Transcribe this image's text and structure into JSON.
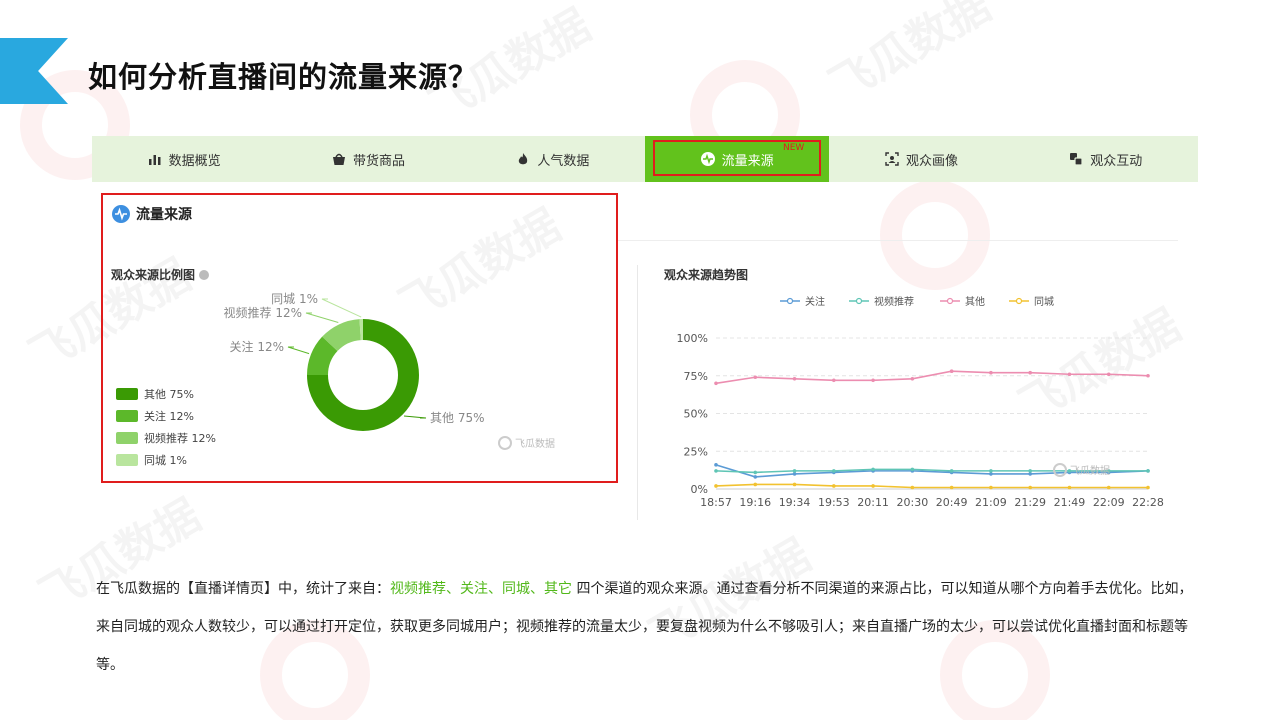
{
  "page": {
    "title": "如何分析直播间的流量来源？"
  },
  "tabs": [
    {
      "label": "数据概览"
    },
    {
      "label": "带货商品"
    },
    {
      "label": "人气数据"
    },
    {
      "label": "流量来源",
      "badge": "NEW",
      "active": true
    },
    {
      "label": "观众画像"
    },
    {
      "label": "观众互动"
    }
  ],
  "section": {
    "title": "流量来源"
  },
  "donut": {
    "title": "观众来源比例图",
    "chart_data": {
      "type": "pie",
      "slices": [
        {
          "name": "其他",
          "value": 75,
          "label": "其他 75%",
          "color": "#3a9a04"
        },
        {
          "name": "关注",
          "value": 12,
          "label": "关注 12%",
          "color": "#5cb82a"
        },
        {
          "name": "视频推荐",
          "value": 12,
          "label": "视频推荐 12%",
          "color": "#8fd26a"
        },
        {
          "name": "同城",
          "value": 1,
          "label": "同城 1%",
          "color": "#b9e59e"
        }
      ]
    },
    "watermark": "飞瓜数据"
  },
  "trend": {
    "title": "观众来源趋势图",
    "chart_data": {
      "type": "line",
      "x": [
        "18:57",
        "19:16",
        "19:34",
        "19:53",
        "20:11",
        "20:30",
        "20:49",
        "21:09",
        "21:29",
        "21:49",
        "22:09",
        "22:28"
      ],
      "y_ticks": [
        "100%",
        "75%",
        "50%",
        "25%",
        "0%"
      ],
      "ylim": [
        0,
        100
      ],
      "legend_position": "top",
      "grid": true,
      "series": [
        {
          "name": "关注",
          "color": "#5b9bd5",
          "values": [
            16,
            8,
            10,
            11,
            12,
            12,
            11,
            10,
            10,
            11,
            11,
            12
          ]
        },
        {
          "name": "视频推荐",
          "color": "#5fc5b5",
          "values": [
            12,
            11,
            12,
            12,
            13,
            13,
            12,
            12,
            12,
            12,
            12,
            12
          ]
        },
        {
          "name": "其他",
          "color": "#ec8db0",
          "values": [
            70,
            74,
            73,
            72,
            72,
            73,
            78,
            77,
            77,
            76,
            76,
            75
          ]
        },
        {
          "name": "同城",
          "color": "#f2c230",
          "values": [
            2,
            3,
            3,
            2,
            2,
            1,
            1,
            1,
            1,
            1,
            1,
            1
          ]
        }
      ]
    },
    "watermark": "飞瓜数据"
  },
  "description": {
    "intro": "在飞瓜数据的【直播详情页】中，统计了来自：",
    "highlight": "视频推荐、关注、同城、其它",
    "rest": " 四个渠道的观众来源。通过查看分析不同渠道的来源占比，可以知道从哪个方向着手去优化。比如，来自同城的观众人数较少，可以通过打开定位，获取更多同城用户；视频推荐的流量太少，要复盘视频为什么不够吸引人；来自直播广场的太少，可以尝试优化直播封面和标题等等。"
  }
}
